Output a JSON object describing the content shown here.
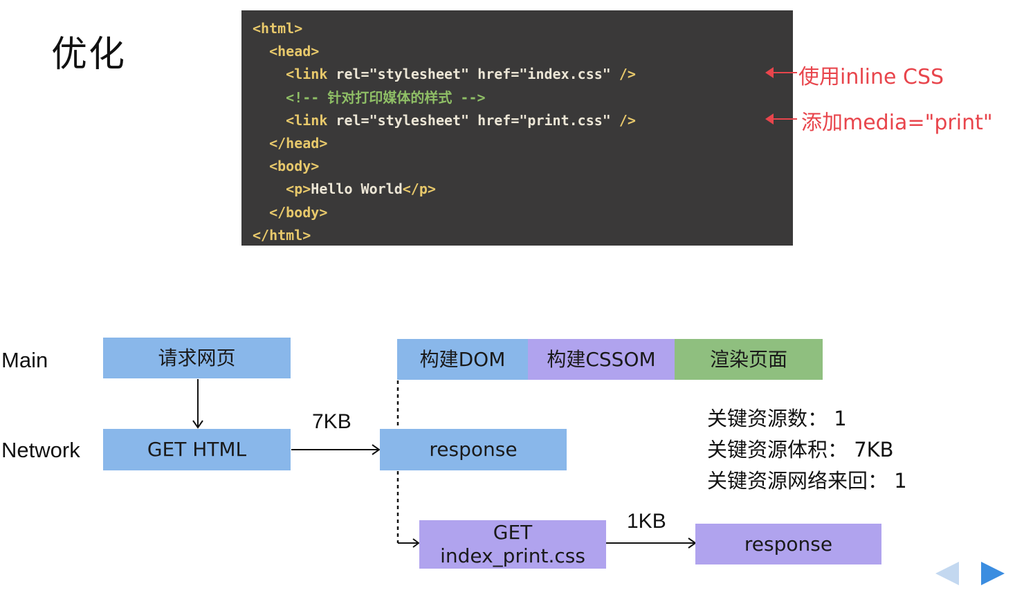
{
  "title": "优化",
  "code": {
    "lines": [
      [
        "<html>"
      ],
      [
        "  ",
        "<head>"
      ],
      [
        "    ",
        "<link",
        " rel=",
        "\"stylesheet\"",
        " href=",
        "\"index.css\"",
        " />"
      ],
      [
        "    ",
        "<!-- 针对打印媒体的样式 -->"
      ],
      [
        "    ",
        "<link",
        " rel=",
        "\"stylesheet\"",
        " href=",
        "\"print.css\"",
        " />"
      ],
      [
        "  ",
        "</head>"
      ],
      [
        "  ",
        "<body>"
      ],
      [
        "    ",
        "<p>",
        "Hello World",
        "</p>"
      ],
      [
        "  ",
        "</body>"
      ],
      [
        "</html>"
      ]
    ]
  },
  "annotations": {
    "inline_css": "使用inline CSS",
    "media_print": "添加media=\"print\""
  },
  "lanes": {
    "main": "Main",
    "network": "Network"
  },
  "boxes": {
    "request_page": "请求网页",
    "get_html": "GET HTML",
    "build_dom": "构建DOM",
    "build_cssom": "构建CSSOM",
    "render_page": "渲染页面",
    "response_html": "response",
    "get_css_line1": "GET",
    "get_css_line2": "index_print.css",
    "response_css": "response"
  },
  "sizes": {
    "html_size": "7KB",
    "css_size": "1KB"
  },
  "stats": {
    "critical_resources": "关键资源数： 1",
    "critical_bytes": "关键资源体积： 7KB",
    "critical_round_trips": "关键资源网络来回： 1"
  },
  "colors": {
    "code_bg": "#3a3939",
    "tag": "#e7c86b",
    "comment": "#8fbf66",
    "annotation": "#e8454c",
    "blue_box": "#89b7ea",
    "purple_box": "#b0a3ee",
    "green_box": "#8fbf7f"
  },
  "nav": {
    "prev_icon": "triangle-left-icon",
    "next_icon": "triangle-right-icon"
  }
}
